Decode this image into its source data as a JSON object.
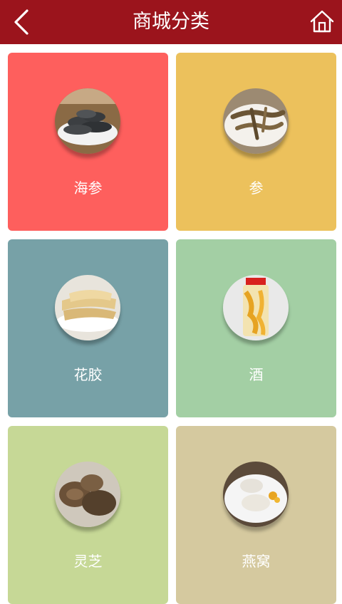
{
  "header": {
    "title": "商城分类",
    "back_icon": "chevron-left-icon",
    "home_icon": "home-icon",
    "color": "#9b141c"
  },
  "categories": [
    {
      "label": "海参",
      "color": "#fe5f5d",
      "image": "sea-cucumber-photo"
    },
    {
      "label": "参",
      "color": "#ecc15c",
      "image": "ginseng-photo"
    },
    {
      "label": "花胶",
      "color": "#77a1a7",
      "image": "fish-maw-photo"
    },
    {
      "label": "酒",
      "color": "#a3cfa4",
      "image": "liquor-jar-photo"
    },
    {
      "label": "灵芝",
      "color": "#c6d896",
      "image": "lingzhi-photo"
    },
    {
      "label": "燕窝",
      "color": "#d5c99f",
      "image": "birds-nest-photo"
    }
  ]
}
